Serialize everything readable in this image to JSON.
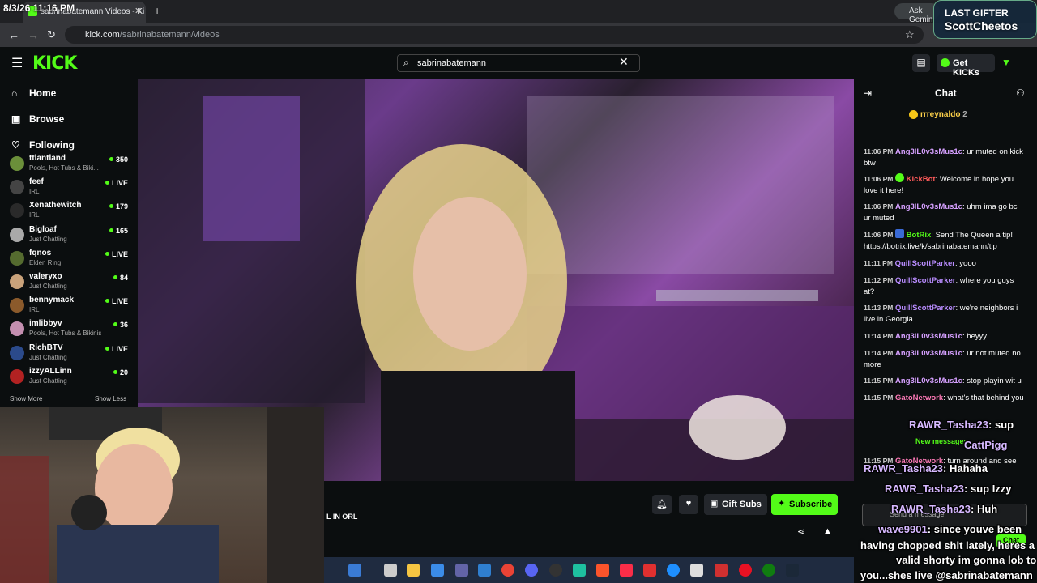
{
  "timestamp": "8/3/26 11:16 PM",
  "browser": {
    "tab_title": "sabrinabatemann Videos - Ki",
    "new_tab": "+",
    "url_host": "kick.com",
    "url_path": "/sabrinabatemann/videos",
    "ask_gemini": "Ask Gemini"
  },
  "gifter": {
    "label": "LAST GIFTER",
    "name": "ScottCheetos"
  },
  "header": {
    "logo": "KICK",
    "search_value": "sabrinabatemann",
    "get_kicks": "Get KICKs"
  },
  "sidebar": {
    "nav": [
      {
        "label": "Home",
        "icon": "home-icon"
      },
      {
        "label": "Browse",
        "icon": "browse-icon"
      },
      {
        "label": "Following",
        "icon": "heart-icon"
      }
    ],
    "channels": [
      {
        "name": "ttlantland",
        "category": "Pools, Hot Tubs & Biki...",
        "viewers": "350",
        "color": "#6b8f3a"
      },
      {
        "name": "feef",
        "category": "IRL",
        "viewers": "LIVE",
        "color": "#444"
      },
      {
        "name": "Xenathewitch",
        "category": "IRL",
        "viewers": "179",
        "color": "#2a2a2a"
      },
      {
        "name": "Bigloaf",
        "category": "Just Chatting",
        "viewers": "165",
        "color": "#a9a9a9"
      },
      {
        "name": "fqnos",
        "category": "Elden Ring",
        "viewers": "LIVE",
        "color": "#556b2f"
      },
      {
        "name": "valeryxo",
        "category": "Just Chatting",
        "viewers": "84",
        "color": "#c9a27a"
      },
      {
        "name": "bennymack",
        "category": "IRL",
        "viewers": "LIVE",
        "color": "#8b5a2b"
      },
      {
        "name": "imlibbyv",
        "category": "Pools, Hot Tubs & Bikinis",
        "viewers": "36",
        "color": "#c48fb0"
      },
      {
        "name": "RichBTV",
        "category": "Just Chatting",
        "viewers": "LIVE",
        "color": "#2b4a8b"
      },
      {
        "name": "izzyALLinn",
        "category": "Just Chatting",
        "viewers": "20",
        "color": "#b22222"
      }
    ],
    "show_more": "Show More",
    "show_less": "Show Less"
  },
  "stream": {
    "tag": "L IN ORL",
    "gift_subs": "Gift Subs",
    "subscribe": "Subscribe"
  },
  "chat": {
    "title": "Chat",
    "pinned_user": "rrreynaldo",
    "pinned_count": "2",
    "messages": [
      {
        "time": "11:06 PM",
        "user": "Ang3lL0v3sMus1c",
        "color": "#d6a0ff",
        "text": "ur muted on kick btw"
      },
      {
        "time": "11:06 PM",
        "user": "KickBot",
        "color": "#ff5a5a",
        "badge": true,
        "text": "Welcome in hope you love it here!"
      },
      {
        "time": "11:06 PM",
        "user": "Ang3lL0v3sMus1c",
        "color": "#d6a0ff",
        "text": "uhm ima go bc ur muted"
      },
      {
        "time": "11:06 PM",
        "user": "BotRix",
        "color": "#53fc18",
        "badge": true,
        "bot": true,
        "text": "Send The Queen a tip! https://botrix.live/k/sabrinabatemann/tip"
      },
      {
        "time": "11:11 PM",
        "user": "QuillScottParker",
        "color": "#b98cff",
        "text": "yooo"
      },
      {
        "time": "11:12 PM",
        "user": "QuillScottParker",
        "color": "#b98cff",
        "text": "where you guys at?"
      },
      {
        "time": "11:13 PM",
        "user": "QuillScottParker",
        "color": "#b98cff",
        "text": "we're neighbors i live in Georgia"
      },
      {
        "time": "11:14 PM",
        "user": "Ang3lL0v3sMus1c",
        "color": "#d6a0ff",
        "text": "heyyy"
      },
      {
        "time": "11:14 PM",
        "user": "Ang3lL0v3sMus1c",
        "color": "#d6a0ff",
        "text": "ur not muted no more"
      },
      {
        "time": "11:15 PM",
        "user": "Ang3lL0v3sMus1c",
        "color": "#d6a0ff",
        "text": "stop playin wit u"
      },
      {
        "time": "11:15 PM",
        "user": "GatoNetwork",
        "color": "#ff7ab8",
        "text": "what's that behind you"
      }
    ],
    "new_messages": "New messages",
    "last_message": {
      "time": "11:15 PM",
      "user": "GatoNetwork",
      "color": "#ff7ab8",
      "text": "turn around and see"
    },
    "input_placeholder": "Send a message",
    "send": "Chat"
  },
  "overlay_chat": [
    {
      "user": "RAWR_Tasha23",
      "text": "sup"
    },
    {
      "user": "CattPigg",
      "text": ""
    },
    {
      "user": "RAWR_Tasha23",
      "text": "Hahaha"
    },
    {
      "user": "RAWR_Tasha23",
      "text": "sup Izzy"
    },
    {
      "user": "RAWR_Tasha23",
      "text": "Huh"
    },
    {
      "user": "wave9901",
      "text": "since youve been"
    }
  ],
  "overlay_tail": [
    "having chopped shit lately, heres a",
    "valid shorty im gonna lob to",
    "you...shes live @sabrinabatemann"
  ],
  "colors": {
    "kick_green": "#53fc18",
    "bg": "#0b0e0f"
  }
}
